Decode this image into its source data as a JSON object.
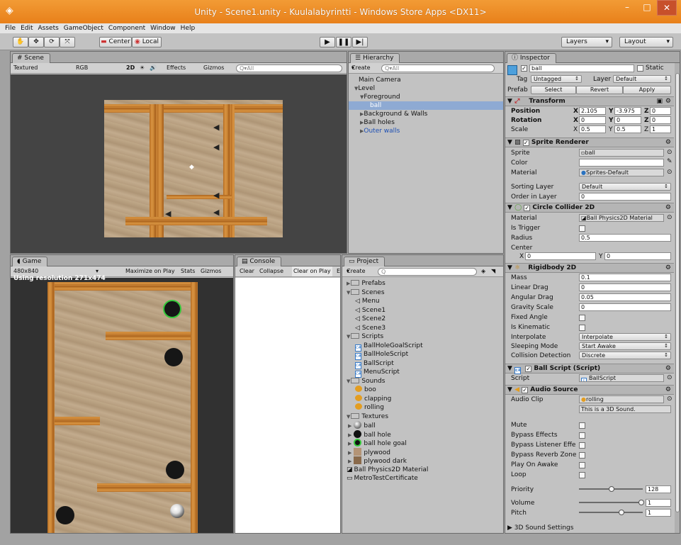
{
  "window": {
    "title": "Unity - Scene1.unity - Kuulalabyrintti - Windows Store Apps <DX11>",
    "min": "–",
    "max": "□",
    "close": "✕"
  },
  "menu": [
    "File",
    "Edit",
    "Assets",
    "GameObject",
    "Component",
    "Window",
    "Help"
  ],
  "toolbar": {
    "pivot": "Center",
    "space": "Local",
    "layers": "Layers",
    "layout": "Layout"
  },
  "scene": {
    "tab": "Scene",
    "shading": "Textured",
    "rgb": "RGB",
    "mode2d": "2D",
    "effects": "Effects",
    "gizmos": "Gizmos",
    "search": "Q▾All"
  },
  "hierarchy": {
    "tab": "Hierarchy",
    "create": "Create",
    "search": "Q▾All",
    "items": [
      {
        "label": "Main Camera",
        "indent": 0,
        "arrow": ""
      },
      {
        "label": "Level",
        "indent": 0,
        "arrow": "▼"
      },
      {
        "label": "Foreground",
        "indent": 1,
        "arrow": "▼"
      },
      {
        "label": "ball",
        "indent": 2,
        "arrow": "",
        "selected": true
      },
      {
        "label": "Background & Walls",
        "indent": 1,
        "arrow": "▶"
      },
      {
        "label": "Ball holes",
        "indent": 1,
        "arrow": "▶"
      },
      {
        "label": "Outer walls",
        "indent": 1,
        "arrow": "▶",
        "blue": true
      }
    ]
  },
  "game": {
    "tab": "Game",
    "aspect": "480x840",
    "maximize": "Maximize on Play",
    "stats": "Stats",
    "gizmos": "Gizmos",
    "resolution": "Using resolution 271x474"
  },
  "console": {
    "tab": "Console",
    "buttons": [
      "Clear",
      "Collapse",
      "Clear on Play",
      "E"
    ]
  },
  "project": {
    "tab": "Project",
    "create": "Create",
    "items": [
      {
        "label": "Prefabs",
        "type": "folder",
        "indent": 0,
        "arrow": "▶"
      },
      {
        "label": "Scenes",
        "type": "folder",
        "indent": 0,
        "arrow": "▼"
      },
      {
        "label": "Menu",
        "type": "scene",
        "indent": 1
      },
      {
        "label": "Scene1",
        "type": "scene",
        "indent": 1
      },
      {
        "label": "Scene2",
        "type": "scene",
        "indent": 1
      },
      {
        "label": "Scene3",
        "type": "scene",
        "indent": 1
      },
      {
        "label": "Scripts",
        "type": "folder",
        "indent": 0,
        "arrow": "▼"
      },
      {
        "label": "BallHoleGoalScript",
        "type": "script",
        "indent": 1
      },
      {
        "label": "BallHoleScript",
        "type": "script",
        "indent": 1
      },
      {
        "label": "BallScript",
        "type": "script",
        "indent": 1
      },
      {
        "label": "MenuScript",
        "type": "script",
        "indent": 1
      },
      {
        "label": "Sounds",
        "type": "folder",
        "indent": 0,
        "arrow": "▼"
      },
      {
        "label": "boo",
        "type": "sound",
        "indent": 1
      },
      {
        "label": "clapping",
        "type": "sound",
        "indent": 1
      },
      {
        "label": "rolling",
        "type": "sound",
        "indent": 1
      },
      {
        "label": "Textures",
        "type": "folder",
        "indent": 0,
        "arrow": "▼"
      },
      {
        "label": "ball",
        "type": "tex-ball",
        "indent": 1
      },
      {
        "label": "ball hole",
        "type": "tex-hole",
        "indent": 1
      },
      {
        "label": "ball hole goal",
        "type": "tex-goal",
        "indent": 1
      },
      {
        "label": "plywood",
        "type": "tex-ply",
        "indent": 1
      },
      {
        "label": "plywood dark",
        "type": "tex-plyd",
        "indent": 1
      },
      {
        "label": "Ball Physics2D Material",
        "type": "material",
        "indent": 0
      },
      {
        "label": "MetroTestCertificate",
        "type": "cert",
        "indent": 0
      }
    ]
  },
  "inspector": {
    "tab": "Inspector",
    "object_name": "ball",
    "static": "Static",
    "tag_label": "Tag",
    "tag": "Untagged",
    "layer_label": "Layer",
    "layer": "Default",
    "prefab_label": "Prefab",
    "select": "Select",
    "revert": "Revert",
    "apply": "Apply",
    "transform": {
      "title": "Transform",
      "position_label": "Position",
      "rotation_label": "Rotation",
      "scale_label": "Scale",
      "px": "2.105",
      "py": "-3.975",
      "pz": "0",
      "rx": "0",
      "ry": "0",
      "rz": "0",
      "sx": "0.5",
      "sy": "0.5",
      "sz": "1"
    },
    "sprite_renderer": {
      "title": "Sprite Renderer",
      "sprite_label": "Sprite",
      "sprite": "ball",
      "color_label": "Color",
      "material_label": "Material",
      "material": "Sprites-Default",
      "sorting_label": "Sorting Layer",
      "sorting": "Default",
      "order_label": "Order in Layer",
      "order": "0"
    },
    "circle_collider": {
      "title": "Circle Collider 2D",
      "material_label": "Material",
      "material": "Ball Physics2D Material",
      "trigger_label": "Is Trigger",
      "radius_label": "Radius",
      "radius": "0.5",
      "center_label": "Center",
      "cx": "0",
      "cy": "0"
    },
    "rigidbody": {
      "title": "Rigidbody 2D",
      "mass_label": "Mass",
      "mass": "0.1",
      "linear_label": "Linear Drag",
      "linear": "0",
      "angular_label": "Angular Drag",
      "angular": "0.05",
      "gravity_label": "Gravity Scale",
      "gravity": "0",
      "fixed_label": "Fixed Angle",
      "kinematic_label": "Is Kinematic",
      "interpolate_label": "Interpolate",
      "interpolate": "Interpolate",
      "sleeping_label": "Sleeping Mode",
      "sleeping": "Start Awake",
      "collision_label": "Collision Detection",
      "collision": "Discrete"
    },
    "ball_script": {
      "title": "Ball Script (Script)",
      "script_label": "Script",
      "script": "BallScript"
    },
    "audio_source": {
      "title": "Audio Source",
      "clip_label": "Audio Clip",
      "clip": "rolling",
      "note": "This is a 3D Sound.",
      "mute": "Mute",
      "bypass_effects": "Bypass Effects",
      "bypass_listener": "Bypass Listener Effe",
      "bypass_reverb": "Bypass Reverb Zone",
      "play_on_awake": "Play On Awake",
      "loop": "Loop",
      "priority_label": "Priority",
      "priority": "128",
      "volume_label": "Volume",
      "volume": "1",
      "pitch_label": "Pitch",
      "pitch": "1",
      "settings": "3D Sound Settings"
    }
  }
}
